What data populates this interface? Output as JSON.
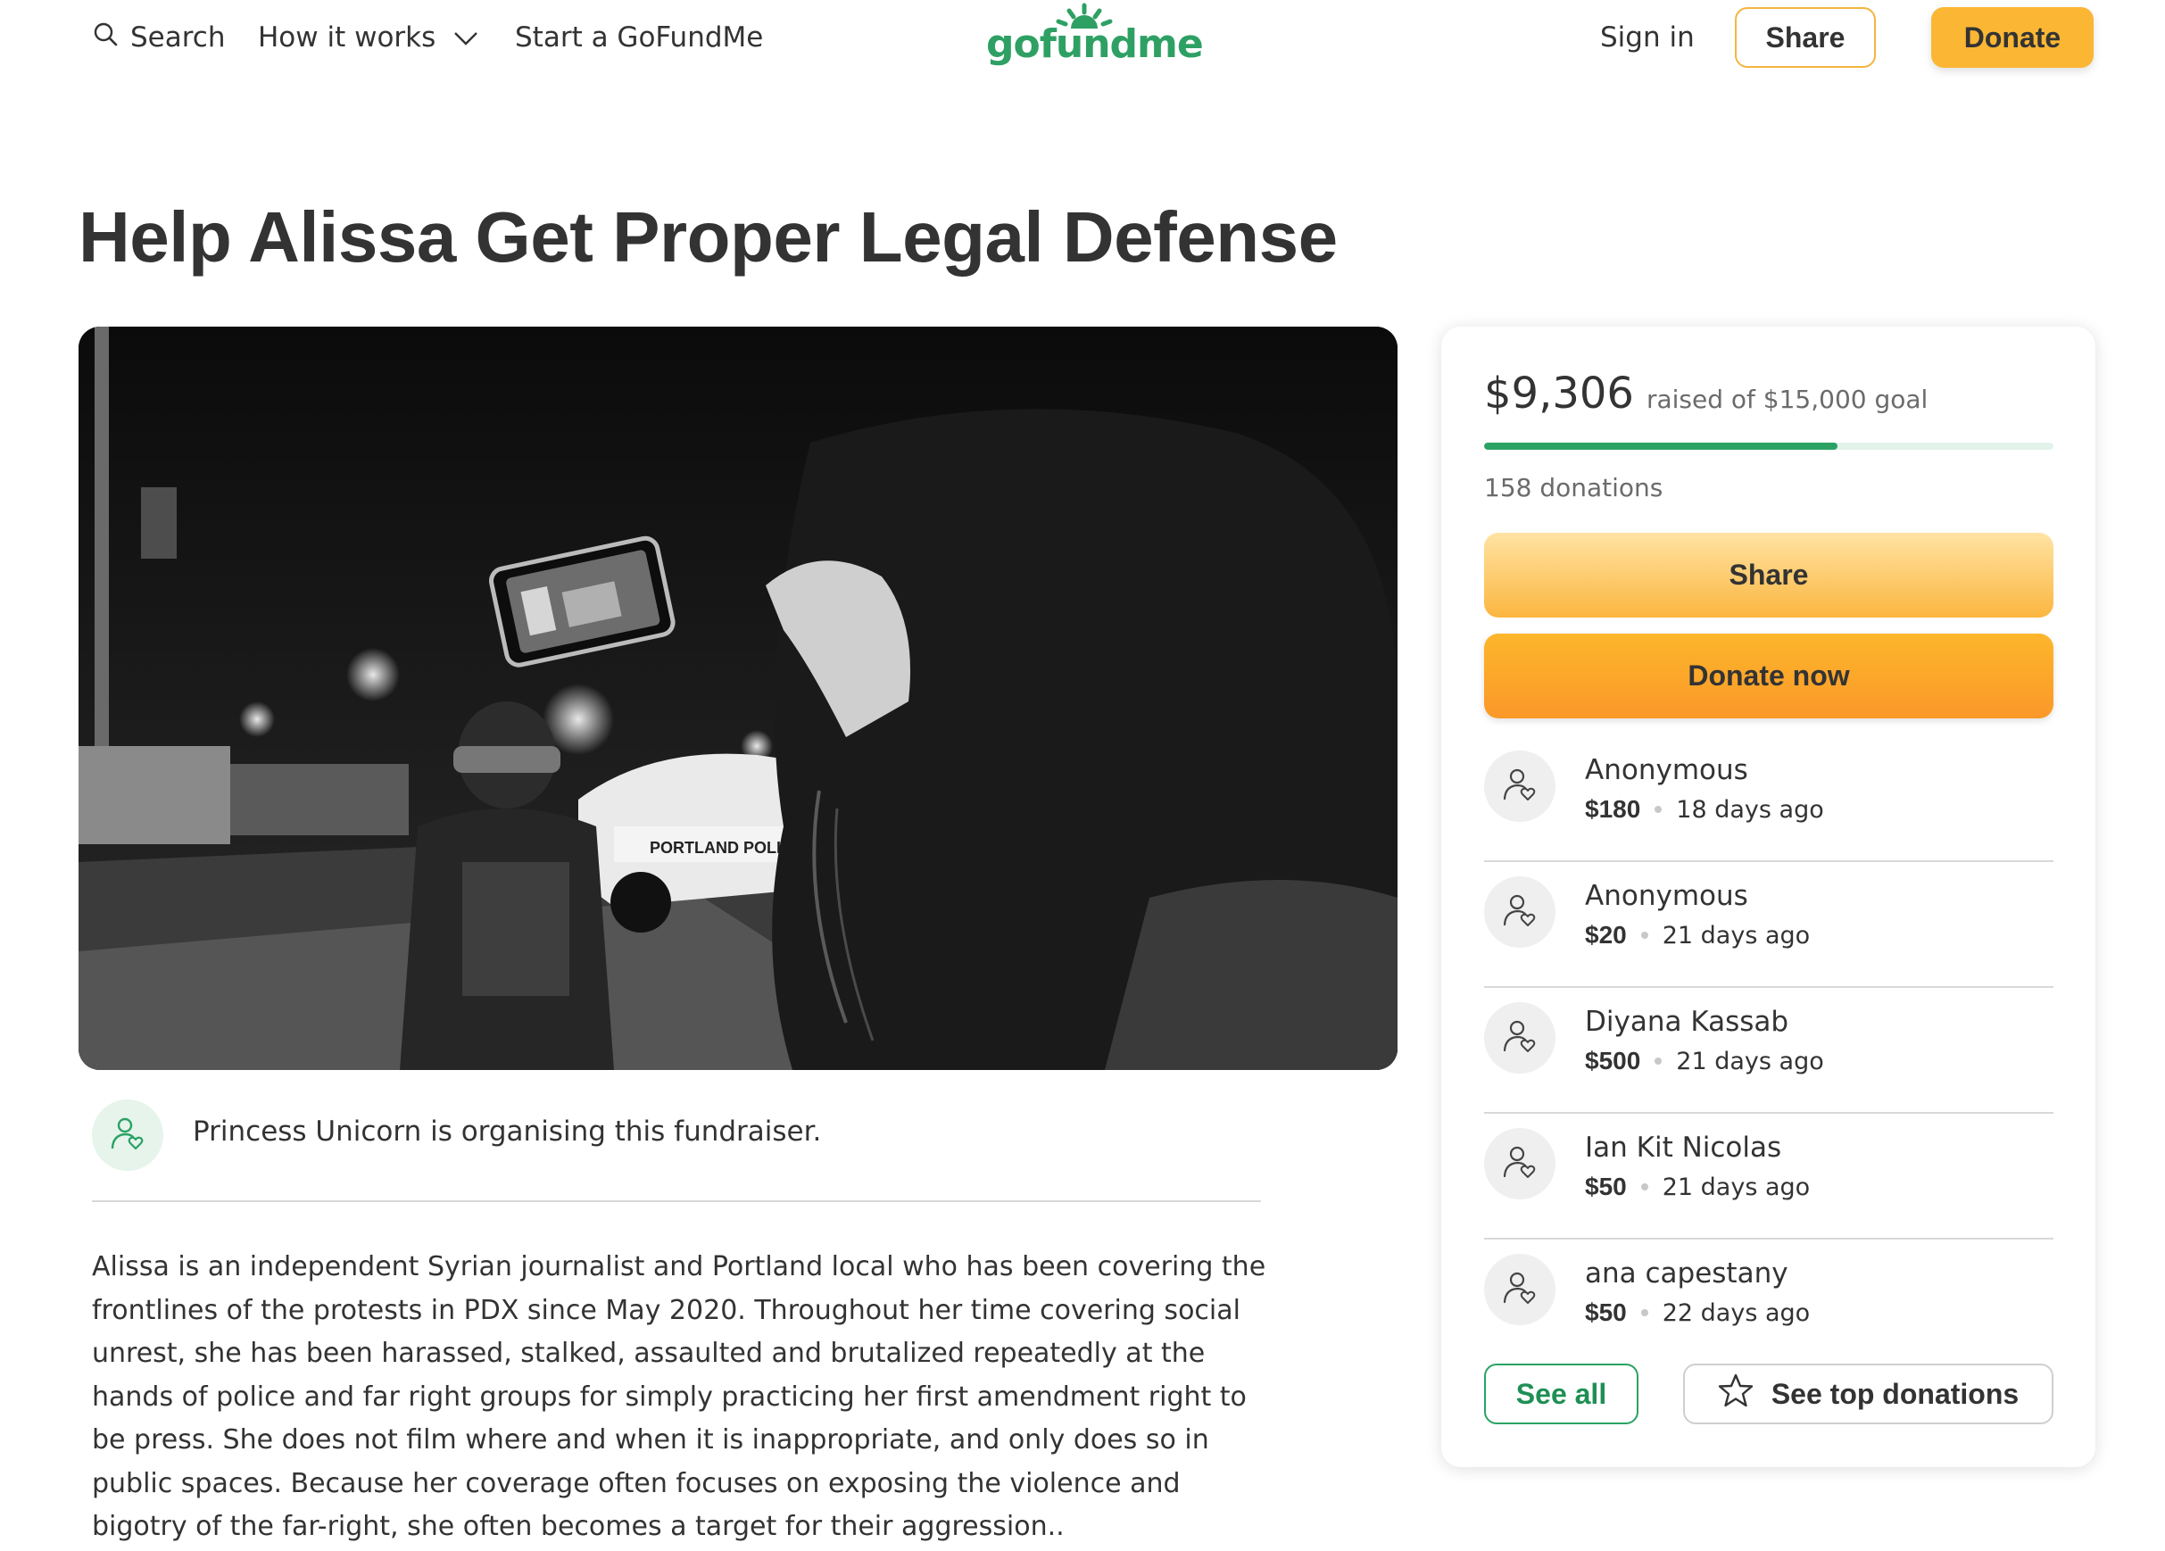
{
  "header": {
    "search_label": "Search",
    "how_label": "How it works",
    "start_label": "Start a GoFundMe",
    "logo_text": "gofundme",
    "signin_label": "Sign in",
    "share_label": "Share",
    "donate_label": "Donate"
  },
  "campaign": {
    "title": "Help Alissa Get Proper Legal Defense",
    "organiser_text": "Princess Unicorn is organising this fundraiser.",
    "story": "Alissa is an independent Syrian journalist and Portland local who has been covering the frontlines of the protests in PDX since May 2020. Throughout her time covering social unrest, she has been harassed, stalked, assaulted and brutalized repeatedly at the hands of police and far right groups for simply practicing her first amendment right to be press. She does not film where and when it is inappropriate, and only does so in public spaces. Because her coverage often focuses on exposing the violence and bigotry of the far-right, she often becomes a target for their aggression..",
    "image_car_text": "PORTLAND POLICE"
  },
  "progress": {
    "raised": "$9,306",
    "goal_text": "raised of $15,000 goal",
    "raised_value": 9306,
    "goal_value": 15000,
    "donation_count": "158 donations"
  },
  "card": {
    "share_label": "Share",
    "donate_label": "Donate now",
    "see_all_label": "See all",
    "top_label": "See top donations"
  },
  "donations": [
    {
      "name": "Anonymous",
      "amount": "$180",
      "time": "18 days ago"
    },
    {
      "name": "Anonymous",
      "amount": "$20",
      "time": "21 days ago"
    },
    {
      "name": "Diyana Kassab",
      "amount": "$500",
      "time": "21 days ago"
    },
    {
      "name": "Ian Kit Nicolas",
      "amount": "$50",
      "time": "21 days ago"
    },
    {
      "name": "ana capestany",
      "amount": "$50",
      "time": "22 days ago"
    }
  ],
  "colors": {
    "brand_green": "#2aa263",
    "donate_orange": "#fbb634",
    "progress_track": "#e2f3ea"
  },
  "icons": [
    "search-icon",
    "chevron-down-icon",
    "user-heart-icon",
    "star-icon"
  ]
}
